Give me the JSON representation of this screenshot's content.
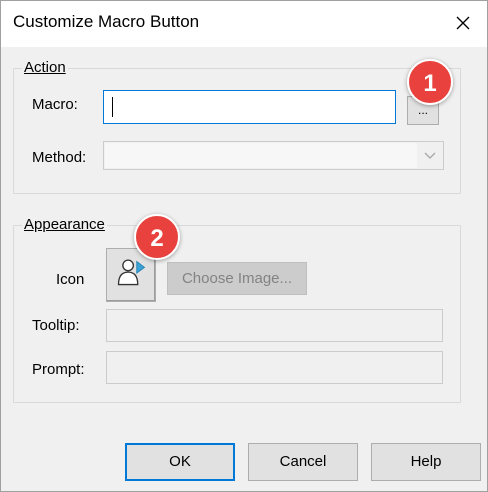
{
  "dialog": {
    "title": "Customize Macro Button",
    "close_icon": "close-icon"
  },
  "action_group": {
    "legend": "Action",
    "macro_label": "Macro:",
    "macro_value": "",
    "browse_label": "...",
    "method_label": "Method:",
    "method_value": ""
  },
  "appearance_group": {
    "legend": "Appearance",
    "icon_label": "Icon",
    "icon_name": "user-arrow-icon",
    "choose_image_label": "Choose Image...",
    "tooltip_label": "Tooltip:",
    "tooltip_value": "",
    "prompt_label": "Prompt:",
    "prompt_value": ""
  },
  "buttons": {
    "ok": "OK",
    "cancel": "Cancel",
    "help": "Help"
  },
  "badges": {
    "first": "1",
    "second": "2",
    "color": "#e8413e"
  }
}
